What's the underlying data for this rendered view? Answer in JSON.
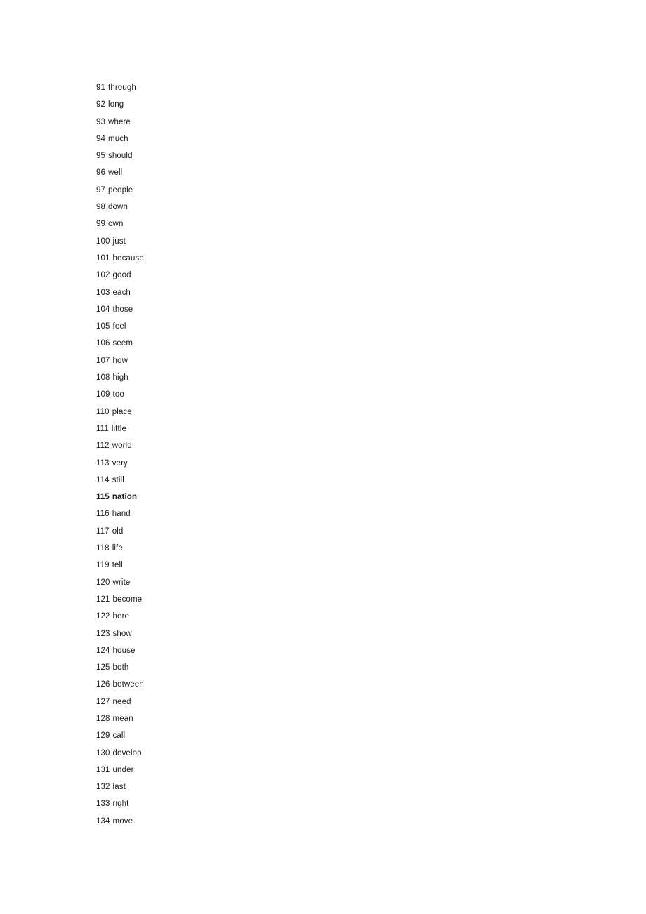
{
  "document": {
    "background_color": "#ffffff",
    "text_color": "#1a1a1a",
    "emphasis_color": "#000000"
  },
  "word_list": {
    "range_start": 91,
    "range_end": 134,
    "entries": [
      {
        "rank": "91",
        "word": "through",
        "emphasized": false
      },
      {
        "rank": "92",
        "word": "long",
        "emphasized": false
      },
      {
        "rank": "93",
        "word": "where",
        "emphasized": false
      },
      {
        "rank": "94",
        "word": "much",
        "emphasized": false
      },
      {
        "rank": "95",
        "word": "should",
        "emphasized": false
      },
      {
        "rank": "96",
        "word": "well",
        "emphasized": false
      },
      {
        "rank": "97",
        "word": "people",
        "emphasized": false
      },
      {
        "rank": "98",
        "word": "down",
        "emphasized": false
      },
      {
        "rank": "99",
        "word": "own",
        "emphasized": false
      },
      {
        "rank": "100",
        "word": "just",
        "emphasized": false
      },
      {
        "rank": "101",
        "word": "because",
        "emphasized": false
      },
      {
        "rank": "102",
        "word": "good",
        "emphasized": false
      },
      {
        "rank": "103",
        "word": "each",
        "emphasized": false
      },
      {
        "rank": "104",
        "word": "those",
        "emphasized": false
      },
      {
        "rank": "105",
        "word": "feel",
        "emphasized": false
      },
      {
        "rank": "106",
        "word": "seem",
        "emphasized": false
      },
      {
        "rank": "107",
        "word": "how",
        "emphasized": false
      },
      {
        "rank": "108",
        "word": "high",
        "emphasized": false
      },
      {
        "rank": "109",
        "word": "too",
        "emphasized": false
      },
      {
        "rank": "110",
        "word": "place",
        "emphasized": false
      },
      {
        "rank": "111",
        "word": "little",
        "emphasized": false
      },
      {
        "rank": "112",
        "word": "world",
        "emphasized": false
      },
      {
        "rank": "113",
        "word": "very",
        "emphasized": false
      },
      {
        "rank": "114",
        "word": "still",
        "emphasized": false
      },
      {
        "rank": "115",
        "word": "nation",
        "emphasized": true
      },
      {
        "rank": "116",
        "word": "hand",
        "emphasized": false
      },
      {
        "rank": "117",
        "word": "old",
        "emphasized": false
      },
      {
        "rank": "118",
        "word": "life",
        "emphasized": false
      },
      {
        "rank": "119",
        "word": "tell",
        "emphasized": false
      },
      {
        "rank": "120",
        "word": "write",
        "emphasized": false
      },
      {
        "rank": "121",
        "word": "become",
        "emphasized": false
      },
      {
        "rank": "122",
        "word": "here",
        "emphasized": false
      },
      {
        "rank": "123",
        "word": "show",
        "emphasized": false
      },
      {
        "rank": "124",
        "word": "house",
        "emphasized": false
      },
      {
        "rank": "125",
        "word": "both",
        "emphasized": false
      },
      {
        "rank": "126",
        "word": "between",
        "emphasized": false
      },
      {
        "rank": "127",
        "word": "need",
        "emphasized": false
      },
      {
        "rank": "128",
        "word": "mean",
        "emphasized": false
      },
      {
        "rank": "129",
        "word": "call",
        "emphasized": false
      },
      {
        "rank": "130",
        "word": "develop",
        "emphasized": false
      },
      {
        "rank": "131",
        "word": "under",
        "emphasized": false
      },
      {
        "rank": "132",
        "word": "last",
        "emphasized": false
      },
      {
        "rank": "133",
        "word": "right",
        "emphasized": false
      },
      {
        "rank": "134",
        "word": "move",
        "emphasized": false
      }
    ]
  }
}
